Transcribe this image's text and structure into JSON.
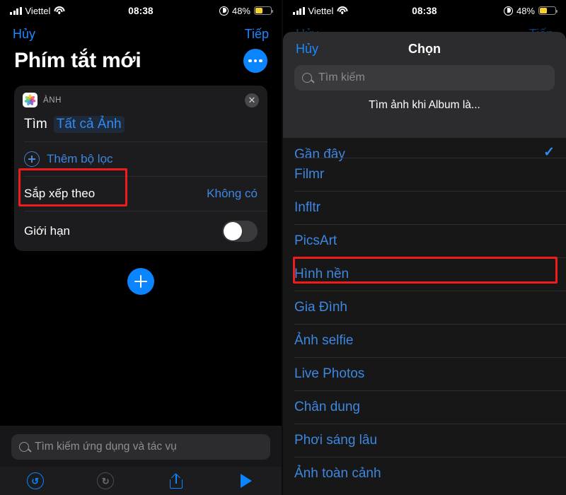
{
  "status_bar": {
    "carrier": "Viettel",
    "time": "08:38",
    "battery_percent": "48%",
    "signal_icon": "cellular-bars-icon",
    "wifi_icon": "wifi-icon",
    "lowpower_icon": "low-power-mode-icon",
    "battery_icon": "battery-icon",
    "battery_color": "#f5d328"
  },
  "left": {
    "nav": {
      "cancel": "Hủy",
      "next": "Tiếp"
    },
    "title": "Phím tắt mới",
    "more_button": "more-options-button",
    "card": {
      "app_label": "ÀNH",
      "app_icon": "photos-app-icon",
      "close_icon": "close-icon",
      "find_label": "Tìm",
      "find_value": "Tất cả Ảnh",
      "add_filter": "Thêm bộ lọc",
      "sort_label": "Sắp xếp theo",
      "sort_value": "Không có",
      "limit_label": "Giới hạn",
      "limit_on": false
    },
    "add_action_button": "add-action-button",
    "search": {
      "placeholder": "Tìm kiếm ứng dụng và tác vụ",
      "icon": "search-icon"
    },
    "toolbar": {
      "undo": "undo-icon",
      "undo_glyph": "↺",
      "redo": "redo-icon",
      "redo_glyph": "↻",
      "share": "share-icon",
      "play": "play-icon"
    },
    "highlight_color": "#ee1c1c"
  },
  "right": {
    "dim_nav": {
      "cancel": "Hủy",
      "next": "Tiếp"
    },
    "sheet": {
      "cancel": "Hủy",
      "title": "Chọn",
      "search_placeholder": "Tìm kiếm",
      "search_icon": "search-icon",
      "hint": "Tìm ảnh khi Album là...",
      "checkmark": "✓",
      "options": [
        {
          "label": "Gần đây",
          "selected": true
        },
        {
          "label": "Filmr",
          "selected": false
        },
        {
          "label": "Infltr",
          "selected": false
        },
        {
          "label": "PicsArt",
          "selected": false
        },
        {
          "label": "Hình nền",
          "selected": false,
          "highlighted": true
        },
        {
          "label": "Gia Đình",
          "selected": false
        },
        {
          "label": "Ảnh selfie",
          "selected": false
        },
        {
          "label": "Live Photos",
          "selected": false
        },
        {
          "label": "Chân dung",
          "selected": false
        },
        {
          "label": "Phơi sáng lâu",
          "selected": false
        },
        {
          "label": "Ảnh toàn cảnh",
          "selected": false
        }
      ]
    },
    "highlight_color": "#ee1c1c"
  }
}
